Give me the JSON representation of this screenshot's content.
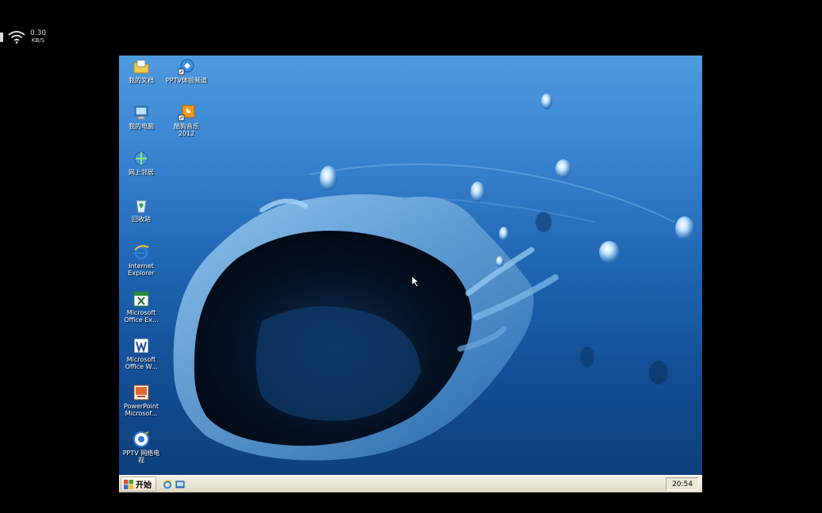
{
  "status_bar": {
    "speed_value": "0.30",
    "speed_unit": "KB/S",
    "icons": [
      "battery-icon",
      "wifi-icon"
    ]
  },
  "desktop": {
    "icons": [
      {
        "label": "我的文档",
        "icon": "folder-documents-icon"
      },
      {
        "label": "PPTV体验频道",
        "icon": "pptv-shortcut-icon"
      },
      {
        "label": "我的电脑",
        "icon": "computer-icon"
      },
      {
        "label": "酷狗音乐\n2012",
        "icon": "music-shortcut-icon"
      },
      {
        "label": "网上邻居",
        "icon": "network-icon"
      },
      {
        "label": "回收站",
        "icon": "recycle-bin-icon"
      },
      {
        "label": "Internet\nExplorer",
        "icon": "internet-explorer-icon"
      },
      {
        "label": "Microsoft\nOffice Ex...",
        "icon": "excel-icon"
      },
      {
        "label": "Microsoft\nOffice W...",
        "icon": "word-icon"
      },
      {
        "label": "PowerPoint\nMicrosof...",
        "icon": "powerpoint-icon"
      },
      {
        "label": "PPTV 网络电\n视",
        "icon": "pptv-icon"
      }
    ]
  },
  "taskbar": {
    "start_label": "开始",
    "clock": "20:54",
    "quick_launch": [
      "ie-quick-launch-icon",
      "show-desktop-icon"
    ]
  },
  "colors": {
    "taskbar": "#ece8d6",
    "wallpaper_top": "#4f9be0",
    "wallpaper_bottom": "#0d3d78"
  }
}
